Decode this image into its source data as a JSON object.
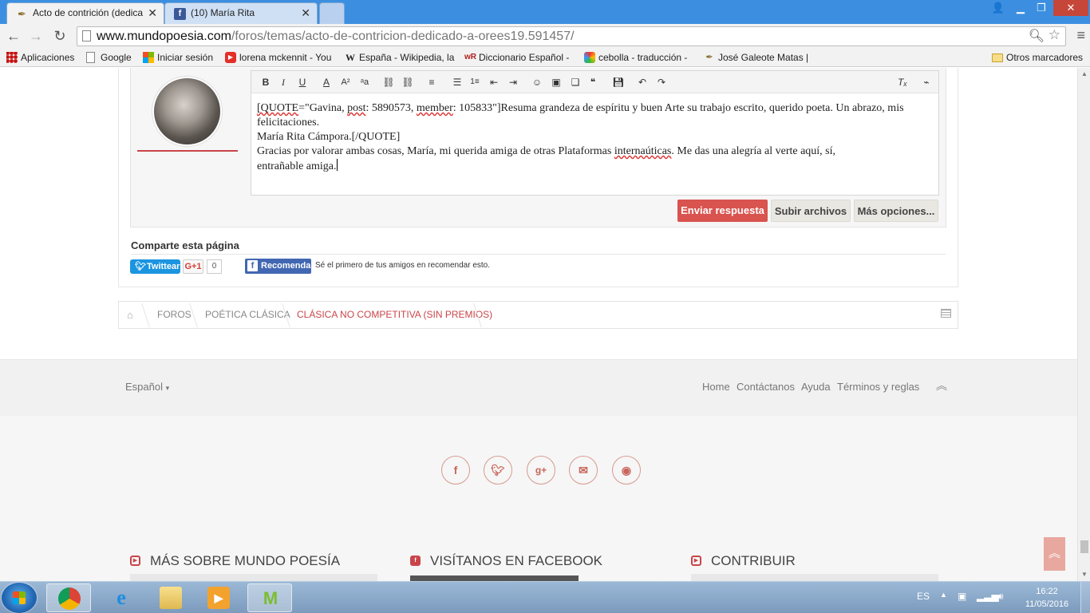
{
  "browser": {
    "tabs": [
      {
        "title": "Acto de contrición (dedica",
        "favicon": "quill-icon"
      },
      {
        "title": "(10) María Rita",
        "favicon": "facebook-icon"
      }
    ],
    "url_domain": "www.mundopoesia.com",
    "url_path": "/foros/temas/acto-de-contricion-dedicado-a-orees19.591457/",
    "bookmarks": [
      {
        "label": "Aplicaciones",
        "icon": "apps-icon"
      },
      {
        "label": "Google",
        "icon": "page-icon"
      },
      {
        "label": "Iniciar sesión",
        "icon": "windows-icon"
      },
      {
        "label": "lorena mckennit - You",
        "icon": "youtube-icon"
      },
      {
        "label": "España - Wikipedia, la",
        "icon": "wikipedia-icon"
      },
      {
        "label": "Diccionario Español -",
        "icon": "wordreference-icon"
      },
      {
        "label": "cebolla - traducción -",
        "icon": "translate-icon"
      },
      {
        "label": "José Galeote Matas |",
        "icon": "quill-icon"
      }
    ],
    "other_bookmarks": "Otros marcadores"
  },
  "editor": {
    "quote_tag_open": "[QUOTE",
    "quote_attr_1": "=\"Gavina, ",
    "quote_post_word": "post",
    "quote_attr_2": ": 5890573, ",
    "quote_member_word": "member",
    "quote_attr_3": ": 105833\"]Resuma grandeza de espíritu y buen Arte su trabajo escrito, querido poeta. Un abrazo, mis felicitaciones.",
    "line_2": "María Rita Cámpora.[/QUOTE]",
    "line_3_a": "Gracias  por valorar ambas cosas, María,  mi querida amiga de  otras Plataformas ",
    "line_3_spell": "internaúticas",
    "line_3_b": ".  Me das  una alegría al  verte aquí, sí,",
    "line_4": " entrañable amiga."
  },
  "buttons": {
    "send": "Enviar respuesta",
    "upload": "Subir archivos",
    "more": "Más opciones..."
  },
  "share": {
    "title": "Comparte esta página",
    "tweet": "Twittear",
    "gplus": "G+1",
    "gplus_count": "0",
    "fb_recommend": "Recomendar",
    "fb_text": "Sé el primero de tus amigos en recomendar esto."
  },
  "breadcrumb": [
    "FOROS",
    "POÉTICA CLÁSICA",
    "CLÁSICA NO COMPETITIVA (SIN PREMIOS)"
  ],
  "footer": {
    "language": "Español",
    "nav": [
      "Home",
      "Contáctanos",
      "Ayuda",
      "Términos y reglas"
    ],
    "sections": [
      "MÁS SOBRE MUNDO POESÍA",
      "VISÍTANOS EN FACEBOOK",
      "CONTRIBUIR"
    ]
  },
  "taskbar": {
    "lang": "ES",
    "time": "16:22",
    "date": "11/05/2016"
  },
  "colors": {
    "accent": "#c9454a",
    "primary_button": "#d9534f",
    "twitter": "#1b95e0",
    "facebook": "#4267b2"
  }
}
